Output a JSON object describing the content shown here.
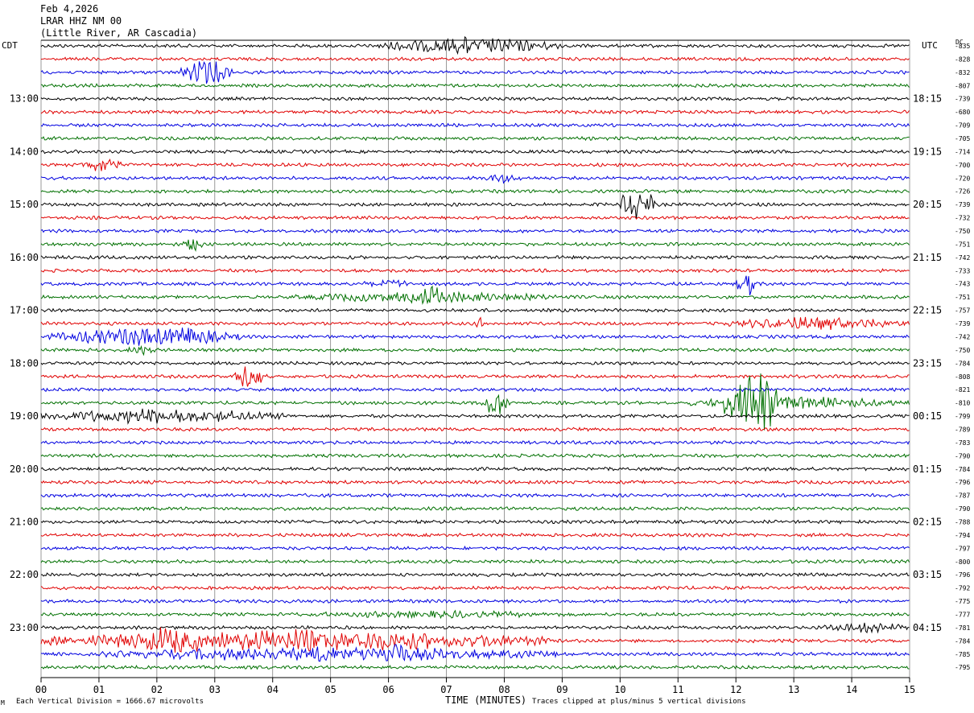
{
  "header": {
    "date": "Feb 4,2026",
    "station": "LRAR HHZ NM 00",
    "location": "(Little River, AR Cascadia)"
  },
  "labels": {
    "left_tz": "CDT",
    "right_tz": "UTC",
    "dc_label": "DC",
    "xlabel": "TIME (MINUTES)",
    "scale_note": "Each Vertical Division = 1666.67 microvolts",
    "clip_note": "Traces clipped at plus/minus 5 vertical divisions",
    "corner_mark": "M"
  },
  "colors": {
    "cycle": [
      "#000000",
      "#e00000",
      "#0000e0",
      "#007000"
    ],
    "grid": "#808080"
  },
  "chart_data": {
    "type": "line",
    "title": "LRAR HHZ NM 00",
    "xlabel": "TIME (MINUTES)",
    "x_ticks": [
      "00",
      "01",
      "02",
      "03",
      "04",
      "05",
      "06",
      "07",
      "08",
      "09",
      "10",
      "11",
      "12",
      "13",
      "14",
      "15"
    ],
    "xlim": [
      0,
      15
    ],
    "n_traces": 48,
    "trace_minutes": 15,
    "left_hour_labels": [
      {
        "trace": 4,
        "text": "13:00"
      },
      {
        "trace": 8,
        "text": "14:00"
      },
      {
        "trace": 12,
        "text": "15:00"
      },
      {
        "trace": 16,
        "text": "16:00"
      },
      {
        "trace": 20,
        "text": "17:00"
      },
      {
        "trace": 24,
        "text": "18:00"
      },
      {
        "trace": 28,
        "text": "19:00"
      },
      {
        "trace": 32,
        "text": "20:00"
      },
      {
        "trace": 36,
        "text": "21:00"
      },
      {
        "trace": 40,
        "text": "22:00"
      },
      {
        "trace": 44,
        "text": "23:00"
      }
    ],
    "right_hour_labels": [
      {
        "trace": 4,
        "text": "18:15"
      },
      {
        "trace": 8,
        "text": "19:15"
      },
      {
        "trace": 12,
        "text": "20:15"
      },
      {
        "trace": 16,
        "text": "21:15"
      },
      {
        "trace": 20,
        "text": "22:15"
      },
      {
        "trace": 24,
        "text": "23:15"
      },
      {
        "trace": 28,
        "text": "00:15"
      },
      {
        "trace": 32,
        "text": "01:15"
      },
      {
        "trace": 36,
        "text": "02:15"
      },
      {
        "trace": 40,
        "text": "03:15"
      },
      {
        "trace": 44,
        "text": "04:15"
      }
    ],
    "dc_offsets": [
      "-835",
      "-828",
      "-832",
      "-807",
      "-739",
      "-680",
      "-709",
      "-705",
      "-714",
      "-700",
      "-720",
      "-726",
      "-739",
      "-732",
      "-750",
      "-751",
      "-742",
      "-733",
      "-743",
      "-751",
      "-757",
      "-739",
      "-742",
      "-750",
      "-784",
      "-808",
      "-821",
      "-810",
      "-799",
      "-789",
      "-783",
      "-790",
      "-784",
      "-796",
      "-787",
      "-790",
      "-788",
      "-794",
      "-797",
      "-800",
      "-796",
      "-792",
      "-775",
      "-777",
      "-781",
      "-784",
      "-785",
      "-795"
    ],
    "events": [
      {
        "trace": 0,
        "start": 5.8,
        "end": 9.0,
        "amp": 9
      },
      {
        "trace": 2,
        "start": 2.4,
        "end": 3.3,
        "amp": 13
      },
      {
        "trace": 9,
        "start": 0.7,
        "end": 1.4,
        "amp": 9
      },
      {
        "trace": 10,
        "start": 7.6,
        "end": 8.3,
        "amp": 5
      },
      {
        "trace": 12,
        "start": 10.0,
        "end": 10.6,
        "amp": 18
      },
      {
        "trace": 15,
        "start": 2.4,
        "end": 2.8,
        "amp": 8
      },
      {
        "trace": 18,
        "start": 5.5,
        "end": 6.5,
        "amp": 5
      },
      {
        "trace": 18,
        "start": 12.0,
        "end": 12.4,
        "amp": 13
      },
      {
        "trace": 19,
        "start": 4.3,
        "end": 9.0,
        "amp": 6
      },
      {
        "trace": 19,
        "start": 6.5,
        "end": 7.0,
        "amp": 12
      },
      {
        "trace": 21,
        "start": 7.5,
        "end": 7.7,
        "amp": 6
      },
      {
        "trace": 21,
        "start": 11.8,
        "end": 15.0,
        "amp": 7
      },
      {
        "trace": 22,
        "start": 0.0,
        "end": 3.5,
        "amp": 9
      },
      {
        "trace": 22,
        "start": 2.0,
        "end": 3.0,
        "amp": 13
      },
      {
        "trace": 23,
        "start": 1.5,
        "end": 2.0,
        "amp": 6
      },
      {
        "trace": 25,
        "start": 3.3,
        "end": 3.9,
        "amp": 13
      },
      {
        "trace": 27,
        "start": 7.6,
        "end": 8.1,
        "amp": 14
      },
      {
        "trace": 27,
        "start": 11.8,
        "end": 12.9,
        "amp": 35
      },
      {
        "trace": 27,
        "start": 11.0,
        "end": 15.0,
        "amp": 7
      },
      {
        "trace": 28,
        "start": 0.0,
        "end": 4.2,
        "amp": 8
      },
      {
        "trace": 43,
        "start": 4.0,
        "end": 9.5,
        "amp": 4
      },
      {
        "trace": 44,
        "start": 13.5,
        "end": 15.0,
        "amp": 6
      },
      {
        "trace": 45,
        "start": 0.0,
        "end": 8.8,
        "amp": 11
      },
      {
        "trace": 45,
        "start": 1.5,
        "end": 3.0,
        "amp": 16
      },
      {
        "trace": 46,
        "start": 1.0,
        "end": 9.0,
        "amp": 8
      },
      {
        "trace": 46,
        "start": 5.9,
        "end": 6.3,
        "amp": 18
      }
    ]
  }
}
